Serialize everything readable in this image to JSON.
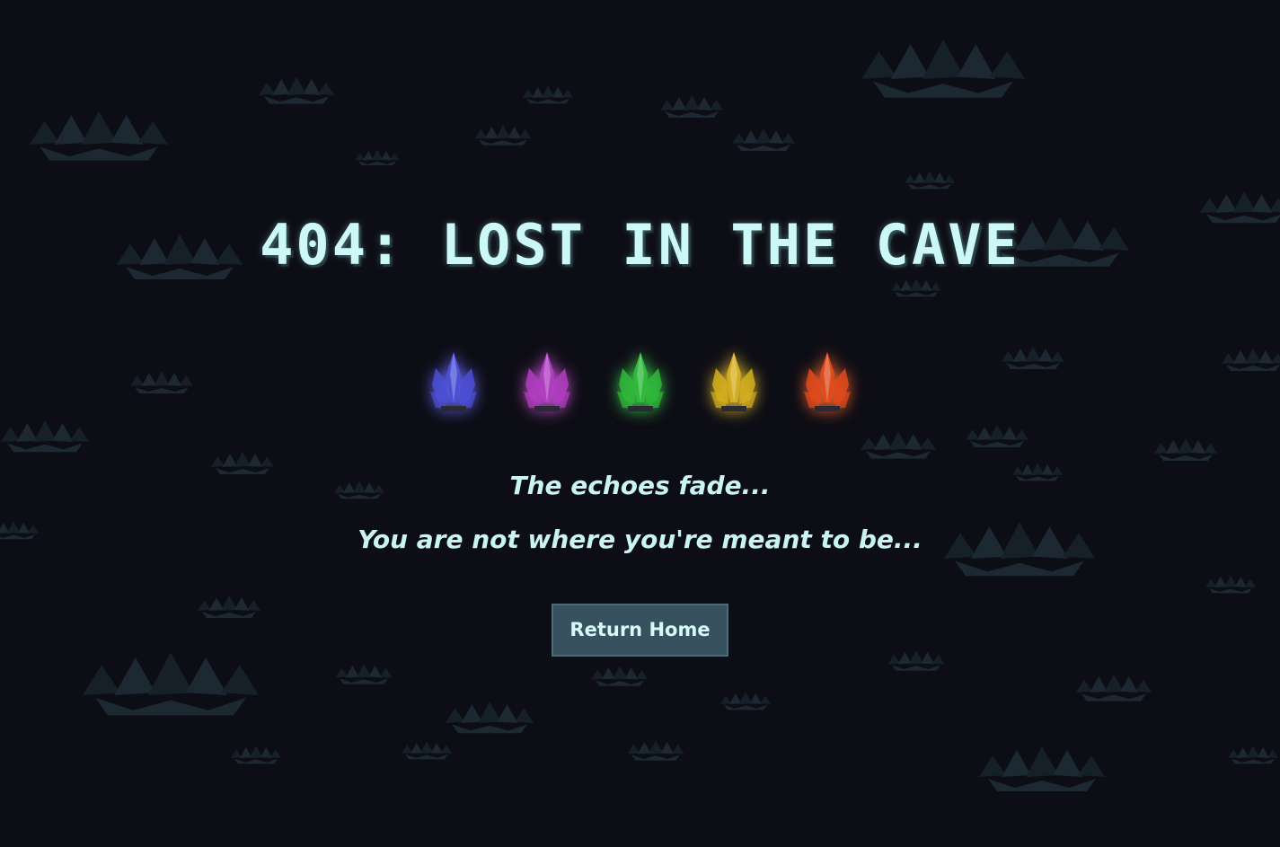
{
  "page": {
    "title": "404: LOST IN THE CAVE",
    "messages": [
      "The echoes fade...",
      "You are not where you're meant to be..."
    ],
    "button_label": "Return Home"
  },
  "crystals": [
    {
      "name": "blue-crystal-icon",
      "color": "#4b4fd6",
      "glow": "#6a6aff"
    },
    {
      "name": "purple-crystal-icon",
      "color": "#b03cc0",
      "glow": "#d45ae0"
    },
    {
      "name": "green-crystal-icon",
      "color": "#2fb83a",
      "glow": "#40e050"
    },
    {
      "name": "yellow-crystal-icon",
      "color": "#d4ae20",
      "glow": "#f0c830"
    },
    {
      "name": "red-crystal-icon",
      "color": "#e04a1c",
      "glow": "#ff6a30"
    }
  ],
  "colors": {
    "background": "#0d0d15",
    "text": "#ccf8f8",
    "button_bg": "#37515e",
    "rock": "#1e2a33"
  }
}
